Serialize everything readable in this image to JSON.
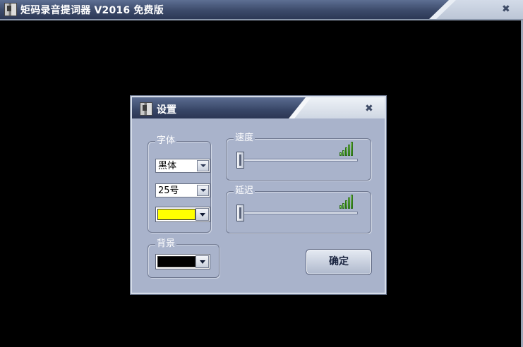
{
  "main_window": {
    "title": "矩码录音提词器 V2016 免费版",
    "close_symbol": "✖"
  },
  "settings_dialog": {
    "title": "设置",
    "close_symbol": "✖",
    "font_group": {
      "label": "字体",
      "font_family": "黑体",
      "font_size": "25号",
      "font_color": "#ffff00"
    },
    "background_group": {
      "label": "背景",
      "background_color": "#000000"
    },
    "speed_group": {
      "label": "速度",
      "level": 0
    },
    "delay_group": {
      "label": "延迟",
      "level": 0
    },
    "ok_button": "确定"
  },
  "icons": [
    "app-icon",
    "close-icon",
    "signal-bars-icon",
    "dropdown-arrow-icon"
  ]
}
